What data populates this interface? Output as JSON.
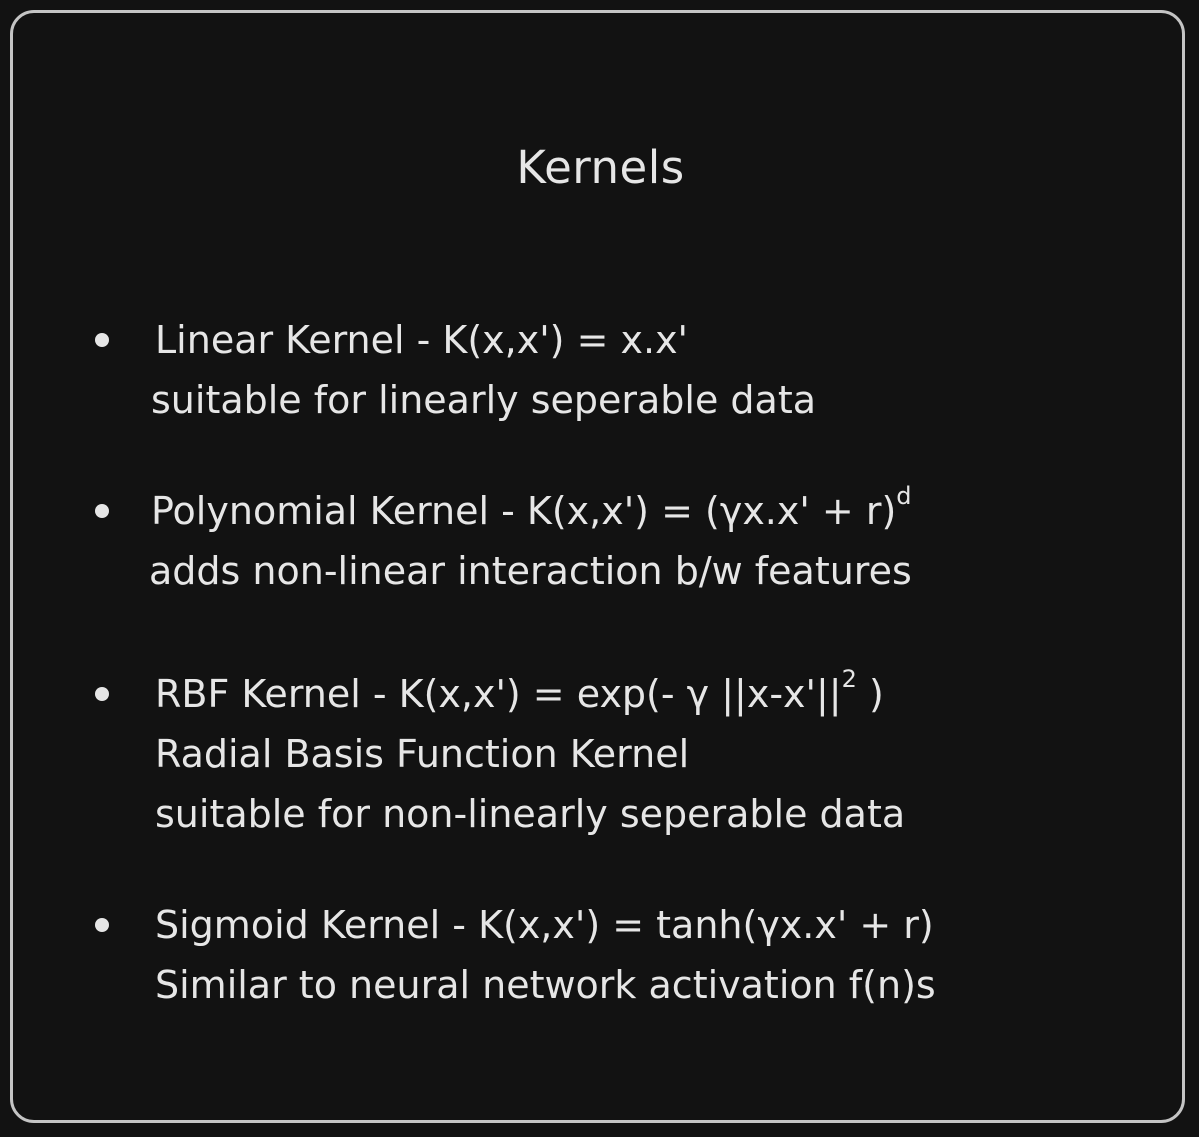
{
  "title": "Kernels",
  "items": [
    {
      "formula": "Linear Kernel - K(x,x') = x.x'",
      "description": [
        "suitable for linearly seperable data"
      ]
    },
    {
      "formula": "Polynomial Kernel - K(x,x') = (γx.x' + r)",
      "formula_sup": "d",
      "description": [
        "adds non-linear interaction b/w features"
      ]
    },
    {
      "formula": "RBF Kernel - K(x,x') = exp(- γ ||x-x'||",
      "formula_sup": "2",
      "formula_tail": " )",
      "description": [
        "Radial Basis Function Kernel",
        "suitable for non-linearly seperable data"
      ]
    },
    {
      "formula": "Sigmoid Kernel - K(x,x') = tanh(γx.x' + r)",
      "description": [
        "Similar to neural network activation f(n)s"
      ]
    }
  ]
}
